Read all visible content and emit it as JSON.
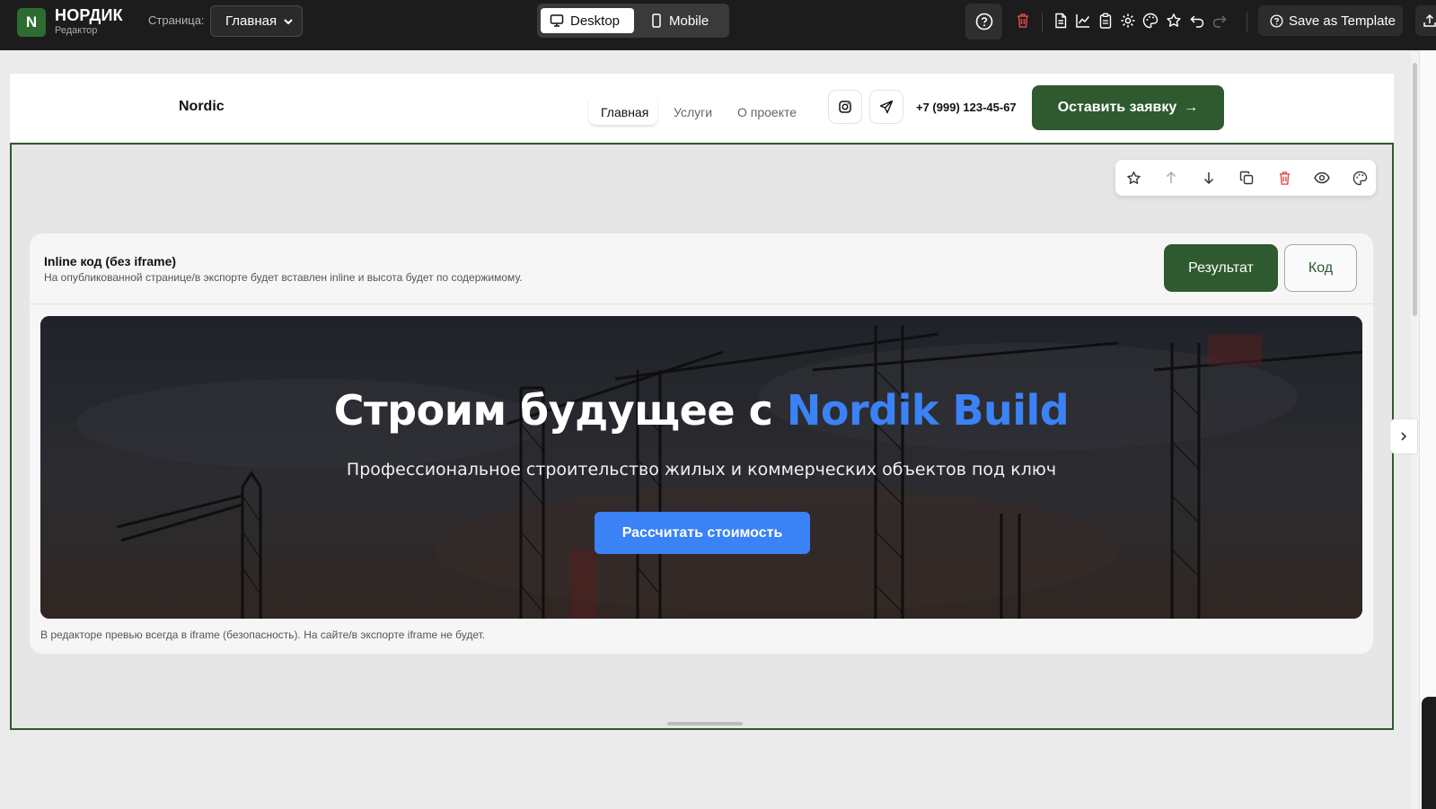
{
  "app": {
    "logo_letter": "N",
    "brand": "НОРДИК",
    "brand_sub": "Редактор",
    "page_label": "Страница:",
    "page_select_value": "Главная",
    "device_desktop": "Desktop",
    "device_mobile": "Mobile",
    "save_template": "Save as Template"
  },
  "site_header": {
    "logo": "Nordic",
    "nav": [
      "Главная",
      "Услуги",
      "О проекте"
    ],
    "phone": "+7 (999) 123-45-67",
    "cta": "Оставить заявку",
    "cta_arrow": "→"
  },
  "block": {
    "title": "Inline код (без iframe)",
    "subtitle": "На опубликованной странице/в экспорте будет вставлен inline и высота будет по содержимому.",
    "tab_result": "Результат",
    "tab_code": "Код",
    "note": "В редакторе превью всегда в iframe (безопасность). На сайте/в экспорте iframe не будет."
  },
  "hero": {
    "title_main": "Строим будущее с ",
    "title_accent": "Nordik Build",
    "subtitle": "Профессиональное строительство жилых и коммерческих объектов под ключ",
    "cta": "Рассчитать стоимость"
  },
  "colors": {
    "brand_green": "#2f5a2f",
    "accent_blue": "#3b82f6",
    "toolbar_bg": "#1c1c1c",
    "danger": "#e04a4a"
  }
}
